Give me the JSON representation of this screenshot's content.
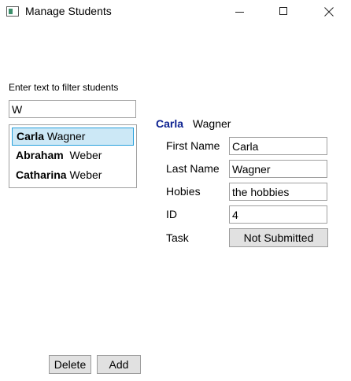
{
  "window": {
    "title": "Manage Students"
  },
  "filter": {
    "label": "Enter text to filter students",
    "value": "W"
  },
  "students": [
    {
      "first": "Carla",
      "last": "Wagner",
      "selected": true
    },
    {
      "first": "Abraham",
      "last": "Weber",
      "selected": false
    },
    {
      "first": "Catharina",
      "last": "Weber",
      "selected": false
    }
  ],
  "detail": {
    "header_first": "Carla",
    "header_last": "Wagner",
    "fields": {
      "first_name_label": "First Name",
      "first_name_value": "Carla",
      "last_name_label": "Last Name",
      "last_name_value": "Wagner",
      "hobbies_label": "Hobies",
      "hobbies_value": "the hobbies",
      "id_label": "ID",
      "id_value": "4",
      "task_label": "Task",
      "task_button": "Not Submitted"
    }
  },
  "actions": {
    "delete_label": "Delete",
    "add_label": "Add"
  },
  "icons": {
    "app": "app-window-icon",
    "minimize": "minimize-icon",
    "maximize": "maximize-icon",
    "close": "close-icon"
  },
  "colors": {
    "selection_fill": "#cce8f6",
    "selection_border": "#27a0dc",
    "header_first_name": "#0a1f8f",
    "button_face": "#e1e1e1"
  }
}
